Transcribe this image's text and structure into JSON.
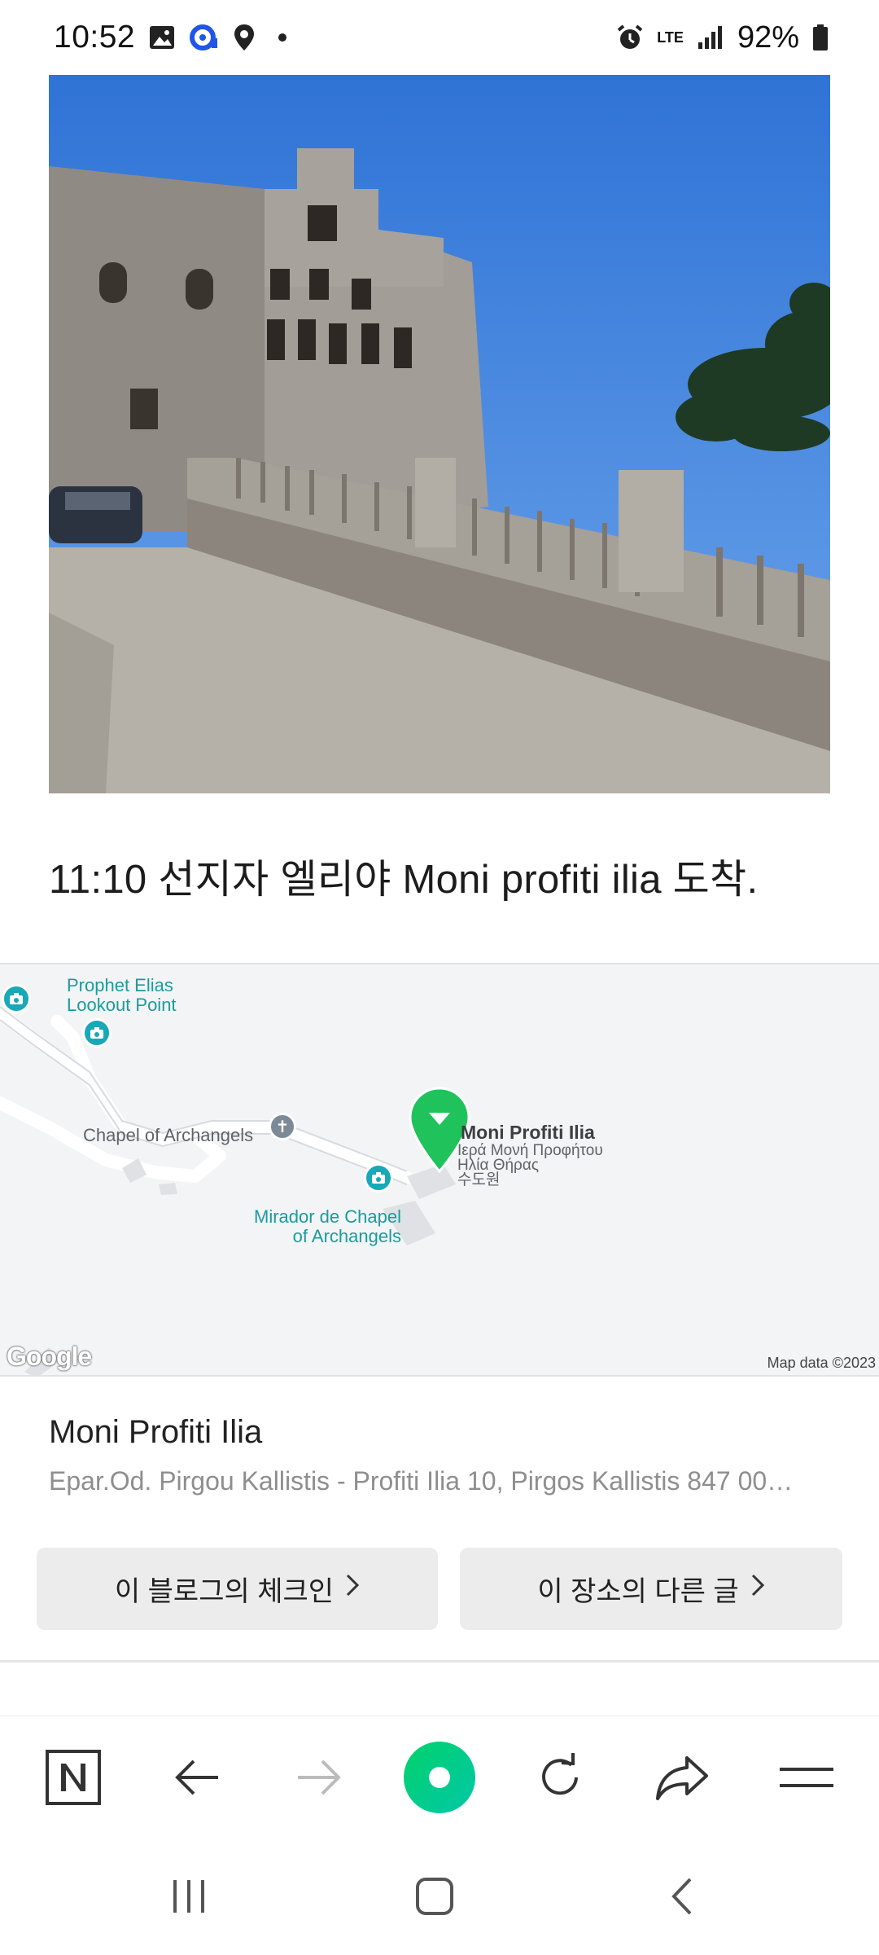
{
  "status_bar": {
    "time": "10:52",
    "network": "LTE",
    "battery": "92%",
    "icons": [
      "gallery-icon",
      "app-notification-icon",
      "location-icon",
      "dot-icon",
      "alarm-icon",
      "lte-icon",
      "signal-icon",
      "battery-icon"
    ]
  },
  "post": {
    "caption": "11:10 선지자 엘리야 Moni profiti ilia 도착."
  },
  "map": {
    "labels": {
      "prophet_elias": "Prophet Elias\nLookout Point",
      "chapel": "Chapel of Archangels",
      "mirador": "Mirador de Chapel\nof Archangels",
      "moni": "Moni Profiti Ilia",
      "greek_1": "Ιερά Μονή Προφήτου",
      "greek_2": "Ηλία Θήρας",
      "korean": "수도원"
    },
    "google": "Google",
    "attribution": "Map data ©2023",
    "accent_color": "#1fc25b"
  },
  "place": {
    "name": "Moni Profiti Ilia",
    "address": "Epar.Od. Pirgou Kallistis - Profiti Ilia 10, Pirgos Kallistis 847 00…"
  },
  "buttons": {
    "blog_checkin": "이 블로그의 체크인",
    "place_posts": "이 장소의 다른 글"
  },
  "toolbar": {
    "items": [
      "naver-home-icon",
      "back-arrow-icon",
      "forward-arrow-icon",
      "green-dot-icon",
      "refresh-icon",
      "share-icon",
      "menu-icon"
    ],
    "brand_color": "#03c75a"
  },
  "system_nav": {
    "items": [
      "recent-apps-icon",
      "home-icon",
      "back-icon"
    ]
  }
}
